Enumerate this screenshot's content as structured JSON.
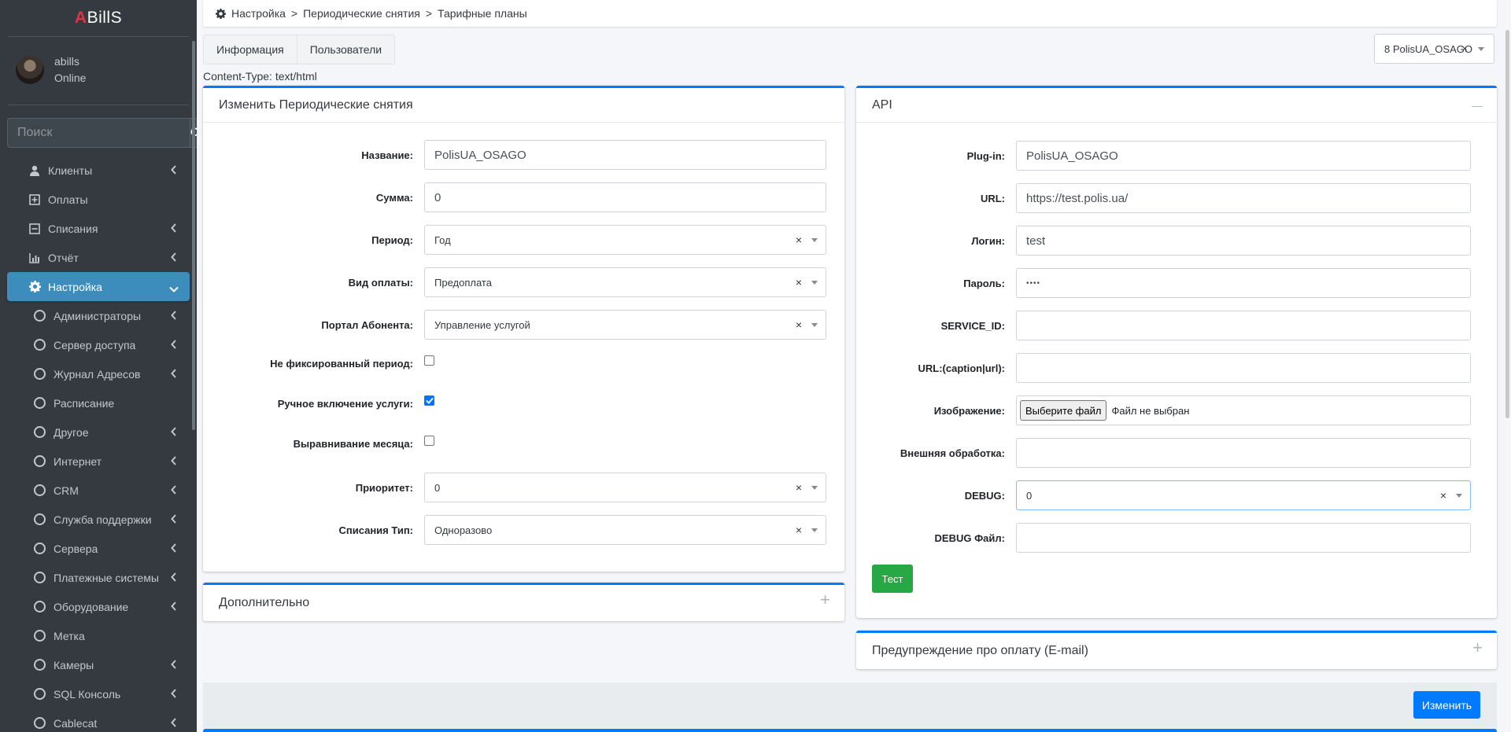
{
  "brand": {
    "first": "A",
    "rest": "BillS"
  },
  "user": {
    "name": "abills",
    "status": "Online"
  },
  "sidebar_search": {
    "placeholder": "Поиск"
  },
  "menu": [
    {
      "label": "Клиенты"
    },
    {
      "label": "Оплаты"
    },
    {
      "label": "Списания"
    },
    {
      "label": "Отчёт"
    },
    {
      "label": "Настройка"
    }
  ],
  "submenu": [
    {
      "label": "Администраторы"
    },
    {
      "label": "Сервер доступа"
    },
    {
      "label": "Журнал Адресов"
    },
    {
      "label": "Расписание"
    },
    {
      "label": "Другое"
    },
    {
      "label": "Интернет"
    },
    {
      "label": "CRM"
    },
    {
      "label": "Служба поддержки"
    },
    {
      "label": "Сервера"
    },
    {
      "label": "Платежные системы"
    },
    {
      "label": "Оборудование"
    },
    {
      "label": "Метка"
    },
    {
      "label": "Камеры"
    },
    {
      "label": "SQL Консоль"
    },
    {
      "label": "Cablecat"
    }
  ],
  "breadcrumb": [
    "Настройка",
    "Периодические снятия",
    "Тарифные планы"
  ],
  "breadcrumb_sep": ">",
  "tabs": [
    "Информация",
    "Пользователи"
  ],
  "top_select": {
    "value": "8 PolisUA_OSAGO",
    "clear": "×"
  },
  "content_type": "Content-Type: text/html",
  "left_card": {
    "title": "Изменить Периодические снятия",
    "fields": {
      "name": {
        "label": "Название:",
        "value": "PolisUA_OSAGO"
      },
      "sum": {
        "label": "Сумма:",
        "value": "0"
      },
      "period": {
        "label": "Период:",
        "value": "Год"
      },
      "payment_type": {
        "label": "Вид оплаты:",
        "value": "Предоплата"
      },
      "portal": {
        "label": "Портал Абонента:",
        "value": "Управление услугой"
      },
      "not_fixed": {
        "label": "Не фиксированный период:",
        "checked": false
      },
      "manual": {
        "label": "Ручное включение услуги:",
        "checked": true
      },
      "align_month": {
        "label": "Выравнивание месяца:",
        "checked": false
      },
      "priority": {
        "label": "Приоритет:",
        "value": "0"
      },
      "fee_type": {
        "label": "Списания Тип:",
        "value": "Одноразово"
      }
    },
    "clear": "×"
  },
  "extra_card": {
    "title": "Дополнительно",
    "tool": "+"
  },
  "api_card": {
    "title": "API",
    "tool": "—",
    "fields": {
      "plugin": {
        "label": "Plug-in:",
        "value": "PolisUA_OSAGO"
      },
      "url": {
        "label": "URL:",
        "value": "https://test.polis.ua/"
      },
      "login": {
        "label": "Логин:",
        "value": "test"
      },
      "password": {
        "label": "Пароль:",
        "value": "••••"
      },
      "service_id": {
        "label": "SERVICE_ID:",
        "value": ""
      },
      "url_caption": {
        "label": "URL:(caption|url):",
        "value": ""
      },
      "image": {
        "label": "Изображение:",
        "button": "Выберите файл",
        "status": "Файл не выбран"
      },
      "external": {
        "label": "Внешняя обработка:",
        "value": ""
      },
      "debug": {
        "label": "DEBUG:",
        "value": "0"
      },
      "debug_file": {
        "label": "DEBUG Файл:",
        "value": ""
      }
    },
    "test_button": "Тест"
  },
  "warn_card": {
    "title": "Предупреждение про оплату (E-mail)",
    "tool": "+"
  },
  "submit_button": "Изменить",
  "colors": {
    "sidebar": "#343a40",
    "active": "#3c8dbc",
    "primary": "#007bff",
    "success": "#28a745"
  }
}
